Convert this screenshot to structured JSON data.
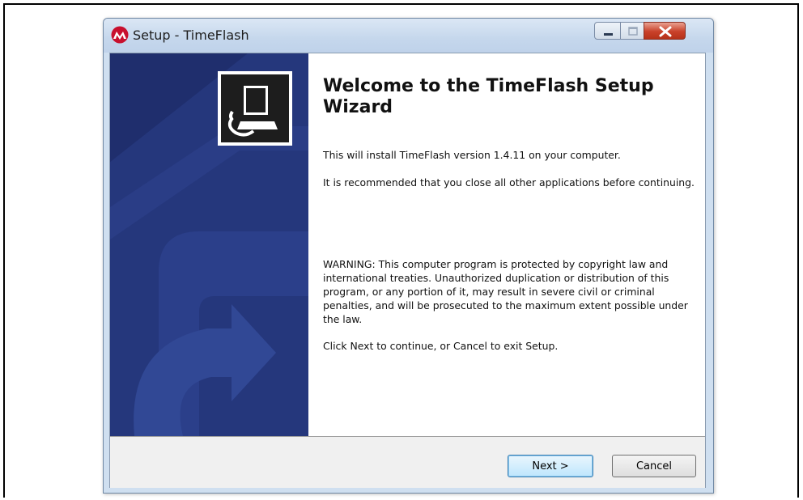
{
  "window": {
    "title": "Setup - TimeFlash",
    "controls": {
      "minimize_icon": "minimize-icon",
      "maximize_icon": "maximize-icon",
      "close_icon": "close-icon"
    }
  },
  "wizard": {
    "heading": "Welcome to the TimeFlash Setup Wizard",
    "install_text": "This will install TimeFlash version 1.4.11 on your computer.",
    "recommend_text": "It is recommended that you close all other applications before continuing.",
    "warning_text": "WARNING: This computer program is protected by copyright law and international treaties.  Unauthorized duplication or distribution of this program, or any portion of it, may result in severe civil or criminal penalties, and will be prosecuted to the maximum extent possible under the law.",
    "click_text": "Click Next to continue, or Cancel to exit Setup."
  },
  "buttons": {
    "next_label": "Next >",
    "cancel_label": "Cancel"
  },
  "colors": {
    "side_panel": "#1f2e6d",
    "close_button": "#c9412a",
    "brand_logo": "#c8102e"
  }
}
